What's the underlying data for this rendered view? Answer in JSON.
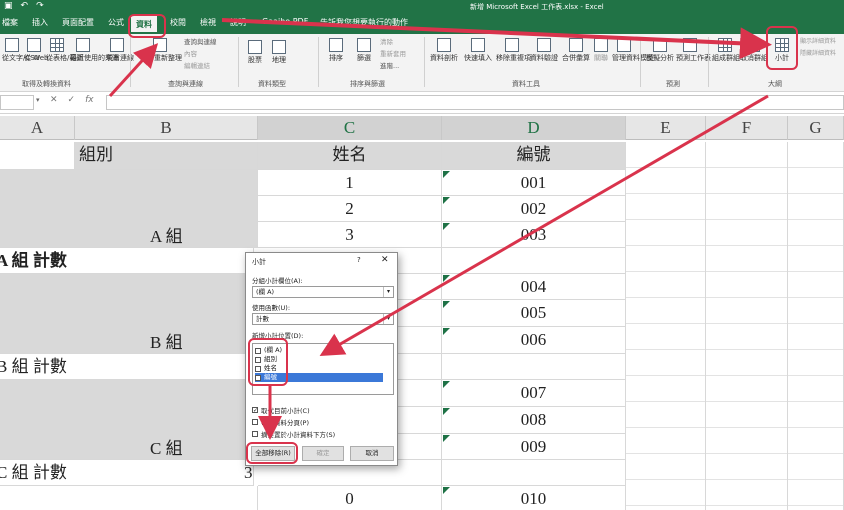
{
  "window": {
    "title": "新增 Microsoft Excel 工作表.xlsx  -  Excel",
    "qat": [
      "自動儲存",
      "↶",
      "↷"
    ]
  },
  "tabs": [
    "檔案",
    "插入",
    "頁面配置",
    "公式",
    "資料",
    "校閱",
    "檢視",
    "說明",
    "Gaaiho PDF",
    "告訴我您想要執行的動作"
  ],
  "active_tab": "資料",
  "ribbon": {
    "get_data": {
      "from_text": "從文字/CSV",
      "from_web": "從 Web",
      "from_table": "從表格/範圍",
      "recent": "最近使用的來源",
      "existing": "現有連線",
      "group": "取得及轉換資料"
    },
    "queries": {
      "refresh_all": "全部重新整理",
      "queries_connections": "查詢與連線",
      "properties": "內容",
      "edit_links": "編輯連結",
      "group": "查詢與連線"
    },
    "data_types": {
      "stocks": "股票",
      "geography": "地理",
      "group": "資料類型"
    },
    "sort_filter": {
      "sort": "排序",
      "filter": "篩選",
      "clear": "清除",
      "reapply": "重新套用",
      "advanced": "進階...",
      "group": "排序與篩選"
    },
    "data_tools": {
      "text_to_columns": "資料剖析",
      "flash_fill": "快速填入",
      "remove_duplicates": "移除重複項",
      "validation": "資料驗證",
      "consolidate": "合併彙算",
      "relationships": "關聯",
      "data_model": "管理資料模型",
      "group": "資料工具"
    },
    "forecast": {
      "what_if": "模擬分析",
      "forecast_sheet": "預測工作表",
      "group": "預測"
    },
    "outline": {
      "group_btn": "組成群組",
      "ungroup": "取消群組",
      "subtotal": "小計",
      "show_detail": "顯示詳細資料",
      "hide_detail": "隱藏詳細資料",
      "group": "大綱"
    }
  },
  "formula_bar": {
    "name_box": "",
    "fx": "fx",
    "cancel": "✕",
    "enter": "✓",
    "value": ""
  },
  "columns": [
    "A",
    "B",
    "C",
    "D",
    "E",
    "F",
    "G"
  ],
  "sheet": {
    "header": {
      "b": "組別",
      "c": "姓名",
      "d": "編號"
    },
    "rows": {
      "c1": "1",
      "d1": "001",
      "c2": "2",
      "d2": "002",
      "b3": "A 組",
      "c3": "3",
      "d3": "003",
      "a4": "A 組 計數",
      "d5": "004",
      "d6": "005",
      "b7": "B 組",
      "d7": "006",
      "a8": "B 組 計數",
      "d9": "007",
      "d10": "008",
      "b11": "C 組",
      "d11": "009",
      "a12": "C 組 計數",
      "b12": "3",
      "c13": "0",
      "d13": "010"
    }
  },
  "dialog": {
    "title": "小計",
    "help": "?",
    "close": "✕",
    "label_field": "分組小計欄位(A):",
    "field_value": "(欄 A)",
    "label_function": "使用函數(U):",
    "function_value": "計數",
    "label_add": "新增小計位置(D):",
    "items": [
      {
        "label": "(欄 A)",
        "checked": false
      },
      {
        "label": "組別",
        "checked": false
      },
      {
        "label": "姓名",
        "checked": false
      },
      {
        "label": "編號",
        "checked": false
      }
    ],
    "opt_replace": {
      "label": "取代目前小計(C)",
      "checked": true
    },
    "opt_pagebreak": {
      "label": "每組資料分頁(P)",
      "checked": false
    },
    "opt_summary": {
      "label": "摘要置於小計資料下方(S)",
      "checked": false
    },
    "btn_remove_all": "全部移除(R)",
    "btn_ok": "確定",
    "btn_cancel": "取消"
  },
  "colors": {
    "excel_green": "#217346",
    "annotation_red": "#d9334c",
    "header_shade": "#d9d9d9"
  },
  "icons": [
    "save-icon",
    "undo-icon",
    "redo-icon",
    "subtotal-icon",
    "group-icon",
    "ungroup-icon",
    "refresh-icon",
    "sort-icon",
    "filter-icon",
    "fx-icon",
    "close-icon"
  ]
}
